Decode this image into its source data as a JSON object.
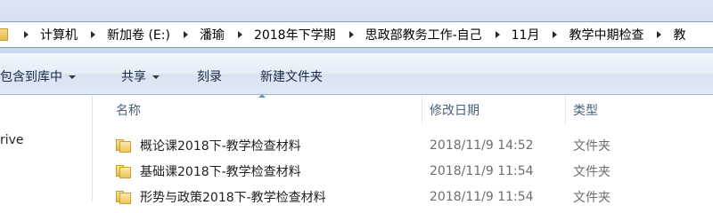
{
  "address_bar": {
    "crumbs": [
      "计算机",
      "新加卷 (E:)",
      "潘瑜",
      "2018年下学期",
      "思政部教务工作-自己",
      "11月",
      "教学中期检查",
      "教"
    ]
  },
  "toolbar": {
    "include_label": "包含到库中",
    "share_label": "共享",
    "burn_label": "刻录",
    "new_folder_label": "新建文件夹"
  },
  "nav_pane": {
    "visible_item": "rive"
  },
  "file_list": {
    "columns": {
      "name": "名称",
      "date": "修改日期",
      "type": "类型"
    },
    "rows": [
      {
        "name": "概论课2018下-教学检查材料",
        "date": "2018/11/9 14:52",
        "type": "文件夹"
      },
      {
        "name": "基础课2018下-教学检查材料",
        "date": "2018/11/9 11:54",
        "type": "文件夹"
      },
      {
        "name": "形势与政策2018下-教学检查材料",
        "date": "2018/11/9 11:54",
        "type": "文件夹"
      }
    ]
  }
}
